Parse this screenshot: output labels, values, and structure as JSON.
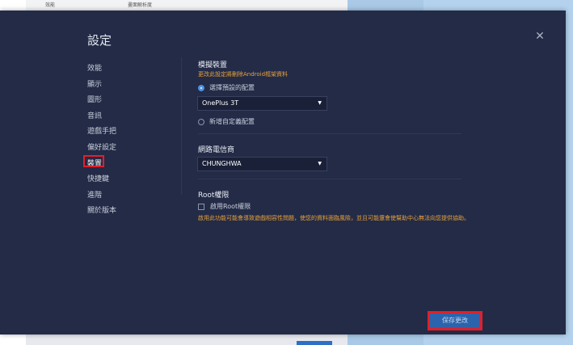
{
  "background": {
    "strip_left_label": "效能",
    "strip_right_label": "畫面解析度"
  },
  "dialog": {
    "title": "設定",
    "close_glyph": "✕"
  },
  "sidebar": {
    "items": [
      {
        "label": "效能"
      },
      {
        "label": "顯示"
      },
      {
        "label": "圖形"
      },
      {
        "label": "音訊"
      },
      {
        "label": "遊戲手把"
      },
      {
        "label": "偏好設定"
      },
      {
        "label": "裝置"
      },
      {
        "label": "快捷鍵"
      },
      {
        "label": "進階"
      },
      {
        "label": "關於版本"
      }
    ],
    "active_index": 6
  },
  "device": {
    "title": "模擬裝置",
    "warning": "更改此設定將刪除Android框架資料",
    "option_preset": "選擇預設的配置",
    "preset_value": "OnePlus 3T",
    "option_custom": "新增自定義配置"
  },
  "carrier": {
    "title": "網路電信商",
    "value": "CHUNGHWA"
  },
  "root": {
    "title": "Root權限",
    "checkbox_label": "啟用Root權限",
    "warning": "啟用此功能可能會導致遊戲相容性問題，使您的資料面臨風險，並且可能還會使幫助中心無法向您提供協助。"
  },
  "footer": {
    "save_label": "保存更改"
  },
  "colors": {
    "panel": "#232b47",
    "accent": "#4a90e2",
    "warning": "#e8a13a",
    "highlight": "#e0202a",
    "save_button": "#2b64ad"
  }
}
